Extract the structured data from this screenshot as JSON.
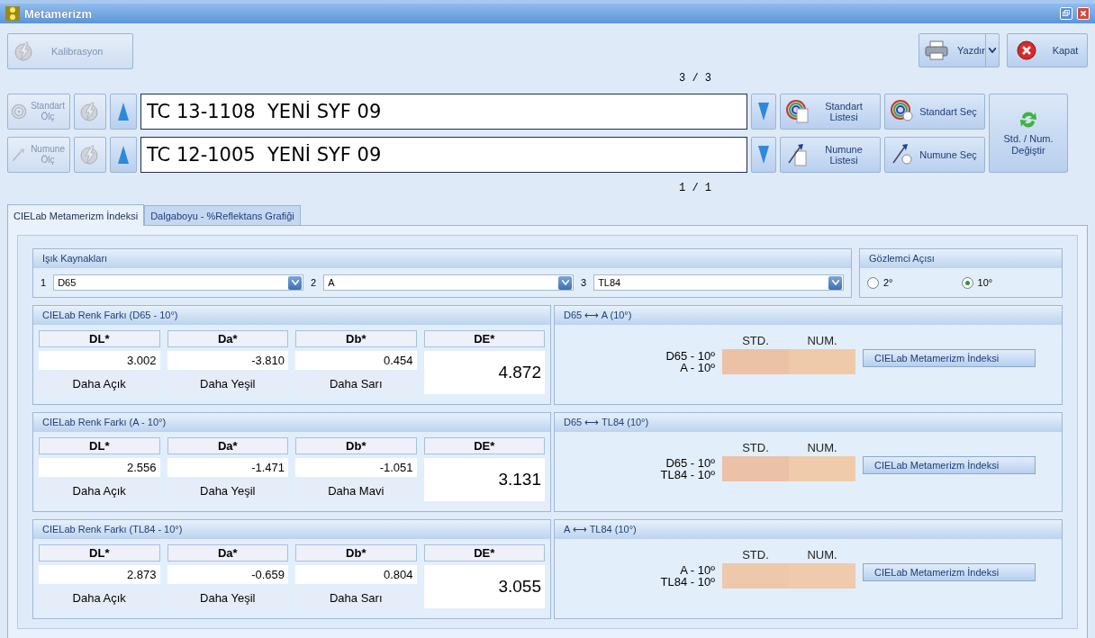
{
  "window": {
    "title": "Metamerizm"
  },
  "toolbar": {
    "calibrate": {
      "label": "Kalibrasyon",
      "disabled": true
    },
    "print": {
      "label": "Yazdır"
    },
    "close": {
      "label": "Kapat"
    }
  },
  "records": [
    {
      "kind": "standard",
      "measure": {
        "label": "Standart Ölç",
        "disabled": true
      },
      "flash_disabled": true,
      "counter": "3 / 3",
      "value": "TC 13-1108  YENİ SYF 09",
      "list_button": "Standart Listesi",
      "select_button": "Standart Seç"
    },
    {
      "kind": "sample",
      "measure": {
        "label": "Numune Ölç",
        "disabled": true
      },
      "flash_disabled": true,
      "counter": "1 / 1",
      "value": "TC 12-1005  YENİ SYF 09",
      "list_button": "Numune Listesi",
      "select_button": "Numune Seç"
    }
  ],
  "swap_button": "Std. / Num. Değiştir",
  "tabs": [
    {
      "label": "CIELab Metamerizm İndeksi",
      "selected": true
    },
    {
      "label": "Dalgaboyu - %Reflektans Grafiği",
      "selected": false
    }
  ],
  "light_sources": {
    "title": "Işık Kaynakları",
    "items": [
      {
        "index": "1",
        "value": "D65"
      },
      {
        "index": "2",
        "value": "A"
      },
      {
        "index": "3",
        "value": "TL84"
      }
    ]
  },
  "observer": {
    "title": "Gözlemci Açısı",
    "options": [
      {
        "label": "2°",
        "selected": false
      },
      {
        "label": "10°",
        "selected": true
      }
    ]
  },
  "difference_panels": [
    {
      "title": "CIELab Renk Farkı (D65 - 10°)",
      "columns": [
        "DL*",
        "Da*",
        "Db*",
        "DE*"
      ],
      "values": [
        "3.002",
        "-3.810",
        "0.454"
      ],
      "descriptions": [
        "Daha Açık",
        "Daha Yeşil",
        "Daha Sarı"
      ],
      "total": "4.872"
    },
    {
      "title": "CIELab Renk Farkı (A - 10°)",
      "columns": [
        "DL*",
        "Da*",
        "Db*",
        "DE*"
      ],
      "values": [
        "2.556",
        "-1.471",
        "-1.051"
      ],
      "descriptions": [
        "Daha Açık",
        "Daha Yeşil",
        "Daha Mavi"
      ],
      "total": "3.131"
    },
    {
      "title": "CIELab Renk Farkı (TL84 - 10°)",
      "columns": [
        "DL*",
        "Da*",
        "Db*",
        "DE*"
      ],
      "values": [
        "2.873",
        "-0.659",
        "0.804"
      ],
      "descriptions": [
        "Daha Açık",
        "Daha Yeşil",
        "Daha Sarı"
      ],
      "total": "3.055"
    }
  ],
  "comparison_panels": [
    {
      "title": "D65 ⟷ A (10°)",
      "rows": [
        "D65 - 10º",
        "A - 10º"
      ],
      "swatches": [
        {
          "label": "STD.",
          "color": "#ecc2a6"
        },
        {
          "label": "NUM.",
          "color": "#efcaaa"
        }
      ],
      "button": "CIELab Metamerizm İndeksi"
    },
    {
      "title": "D65 ⟷ TL84 (10°)",
      "rows": [
        "D65 - 10º",
        "TL84 - 10º"
      ],
      "swatches": [
        {
          "label": "STD.",
          "color": "#ebc2a8"
        },
        {
          "label": "NUM.",
          "color": "#efcbac"
        }
      ],
      "button": "CIELab Metamerizm İndeksi"
    },
    {
      "title": "A ⟷ TL84 (10°)",
      "rows": [
        "A - 10º",
        "TL84 - 10º"
      ],
      "swatches": [
        {
          "label": "STD.",
          "color": "#eec8aa"
        },
        {
          "label": "NUM.",
          "color": "#efcaad"
        }
      ],
      "button": "CIELab Metamerizm İndeksi"
    }
  ]
}
